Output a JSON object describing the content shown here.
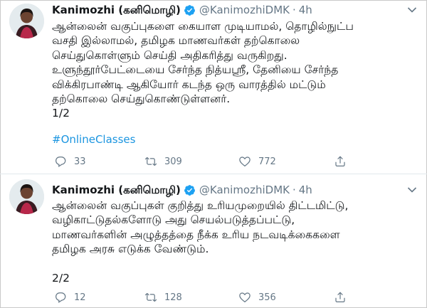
{
  "tweets": [
    {
      "author": {
        "name": "Kanimozhi (கனிமொழி)",
        "handle": "@KanimozhiDMK",
        "verified": true
      },
      "time": "4h",
      "text": "ஆன்லைன் வகுப்புகளை கையாள முடியாமல், தொழில்நுட்ப\nவசதி இல்லாமல், தமிழக மாணவர்கள் தற்கொலை\nசெய்துகொள்ளும் செய்தி அதிகரித்து வருகிறது.\nஉளுந்தூர்பேட்டையை சேர்ந்த நித்யஸ்ரீ, தேனியை சேர்ந்த\nவிக்கிரபாண்டி ஆகியோர் கடந்த ஒரு வாரத்தில் மட்டும்\nதற்கொலை செய்துகொண்டுள்ளனர்.\n1/2",
      "hashtag": "#OnlineClasses",
      "stats": {
        "replies": "33",
        "retweets": "309",
        "likes": "772"
      }
    },
    {
      "author": {
        "name": "Kanimozhi (கனிமொழி)",
        "handle": "@KanimozhiDMK",
        "verified": true
      },
      "time": "4h",
      "text": "ஆன்லைன் வகுப்புகள் குறித்து உரியமுறையில் திட்டமிட்டு,\nவழிகாட்டுதல்களோடு அது செயல்படுத்தப்பட்டு,\nமாணவர்களின் அழுத்தத்தை நீக்க உரிய நடவடிக்கைகளை\nதமிழக அரசு எடுக்க வேண்டும்.\n\n2/2",
      "stats": {
        "replies": "12",
        "retweets": "128",
        "likes": "356"
      }
    }
  ],
  "colors": {
    "accent": "#1da1f2",
    "text": "#14171a",
    "muted": "#657786",
    "link": "#1b95e0"
  },
  "icons": [
    "avatar",
    "verified-badge-icon",
    "chevron-down-icon",
    "reply-icon",
    "retweet-icon",
    "like-icon",
    "share-icon"
  ]
}
